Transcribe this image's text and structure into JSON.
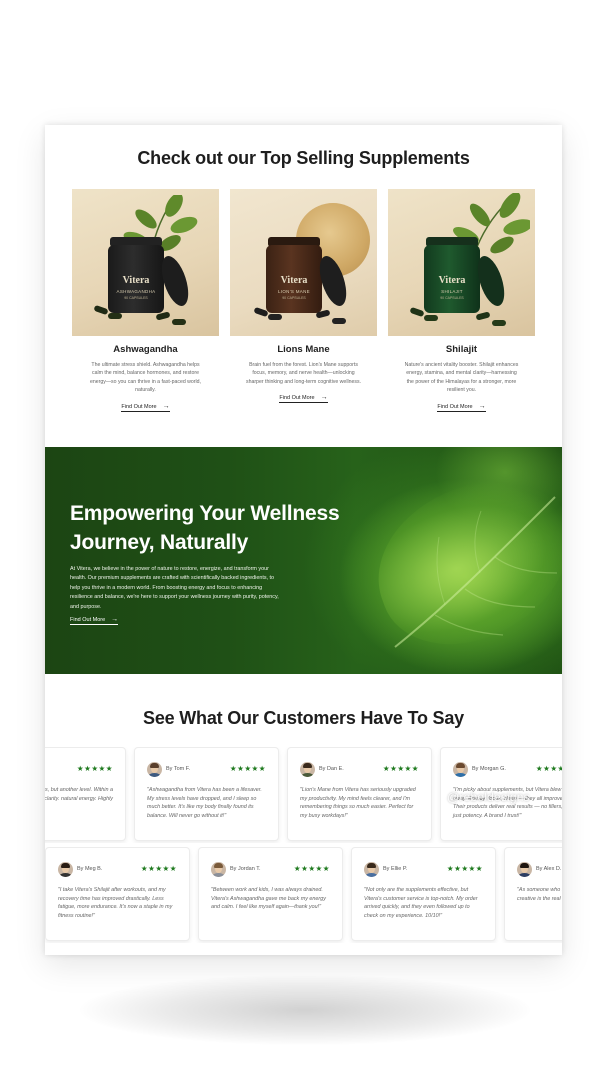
{
  "top_section": {
    "title": "Check out our Top Selling Supplements",
    "products": [
      {
        "name": "Ashwagandha",
        "jar_brand": "Vitera",
        "jar_label": "ASHWAGANDHA",
        "jar_sub": "90 CAPSULES",
        "description": "The ultimate stress shield. Ashwagandha helps calm the mind, balance hormones, and restore energy—so you can thrive in a fast-paced world, naturally.",
        "link": "Find Out More",
        "arrow": "→"
      },
      {
        "name": "Lions Mane",
        "jar_brand": "Vitera",
        "jar_label": "LION'S MANE",
        "jar_sub": "90 CAPSULES",
        "description": "Brain fuel from the forest. Lion's Mane supports focus, memory, and nerve health—unlocking sharper thinking and long-term cognitive wellness.",
        "link": "Find Out More",
        "arrow": "→"
      },
      {
        "name": "Shilajit",
        "jar_brand": "Vitera",
        "jar_label": "SHILAJIT",
        "jar_sub": "90 CAPSULES",
        "description": "Nature's ancient vitality booster. Shilajit enhances energy, stamina, and mental clarity—harnessing the power of the Himalayas for a stronger, more resilient you.",
        "link": "Find Out More",
        "arrow": "→"
      }
    ]
  },
  "hero": {
    "headline": "Empowering Your Wellness Journey, Naturally",
    "body": "At Vitera, we believe in the power of nature to restore, energize, and transform your health. Our premium supplements are crafted with scientifically backed ingredients, to help you thrive in a modern world. From boosting energy and focus to enhancing resilience and balance, we're here to support your wellness journey with purity, potency, and purpose.",
    "link": "Find Out More",
    "arrow": "→"
  },
  "reviews": {
    "title": "See What Our Customers Have To Say",
    "stars": "★★★★★",
    "row1": [
      {
        "name": "",
        "quote": "energy supplements, but another level. Within a and mental clarity. natural energy. Highly"
      },
      {
        "name": "By Tom F.",
        "quote": "\"Ashwagandha from Vitera has been a lifesaver. My stress levels have dropped, and I sleep so much better. It's like my body finally found its balance. Will never go without it!\""
      },
      {
        "name": "By Dan E.",
        "quote": "\"Lion's Mane from Vitera has seriously upgraded my productivity. My mind feels clearer, and I'm remembering things so much easier. Perfect for my busy workdays!\""
      },
      {
        "name": "By Morgan G.",
        "quote": "\"I'm picky about supplements, but Vitera blew me away. Energy, focus, sleep — they all improved. Their products deliver real results — no fillers, just potency. A brand I trust!\""
      }
    ],
    "row2": [
      {
        "name": "By Meg B.",
        "quote": "\"I take Vitera's Shilajit after workouts, and my recovery time has improved drastically. Less fatigue, more endurance. It's now a staple in my fitness routine!\""
      },
      {
        "name": "By Jordan T.",
        "quote": "\"Between work and kids, I was always drained. Vitera's Ashwagandha gave me back my energy and calm. I feel like myself again—thank you!\""
      },
      {
        "name": "By Ellie P.",
        "quote": "\"Not only are the supplements effective, but Vitera's customer service is top-notch. My order arrived quickly, and they even followed up to check on my experience. 10/10!\""
      },
      {
        "name": "By Alex D.",
        "quote": "\"As someone who Lion's Mane has focused, creative is the real deal!\""
      }
    ]
  },
  "watermark": "@rebeldesigns"
}
